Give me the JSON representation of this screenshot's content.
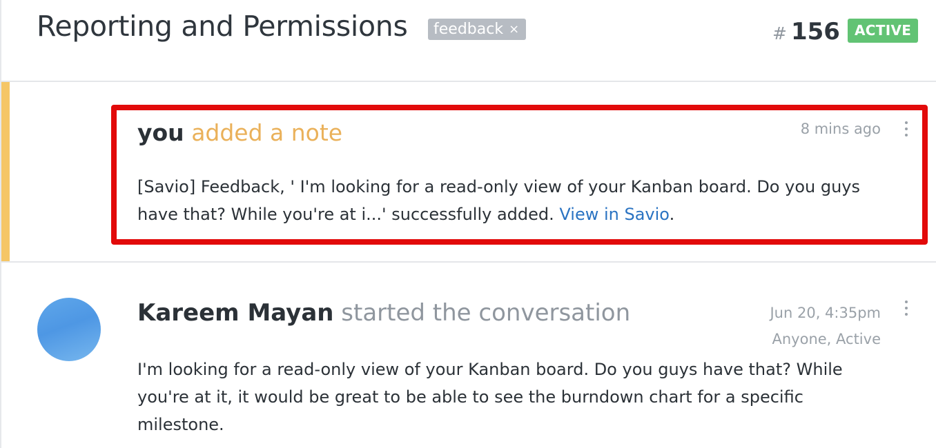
{
  "header": {
    "title": "Reporting and Permissions",
    "tag": {
      "label": "feedback",
      "remove_glyph": "×"
    },
    "conversation_number_prefix": "#",
    "conversation_number": "156",
    "status": "ACTIVE"
  },
  "note": {
    "author": "you",
    "action": "added a note",
    "time": "8 mins ago",
    "body_text": "[Savio] Feedback, ' I'm looking for a read-only view of your Kanban board. Do you guys have that? While you're at i...' successfully added. ",
    "link_text": "View in Savio",
    "body_suffix": ".",
    "accent_color": "#f5c666",
    "highlight_color": "#e20a0a"
  },
  "message": {
    "author": "Kareem Mayan",
    "action": "started the conversation",
    "date": "Jun 20, 4:35pm",
    "visibility": "Anyone, Active",
    "body": "I'm looking for a read-only view of your Kanban board. Do you guys have that? While you're at it, it would be great to be able to see the burndown chart for a specific milestone."
  },
  "colors": {
    "status_badge": "#62c374",
    "tag_background": "#b7bcc3",
    "link": "#2a73c2"
  },
  "icons": {
    "tag_remove": "close-icon",
    "menu": "more-vertical-icon"
  }
}
